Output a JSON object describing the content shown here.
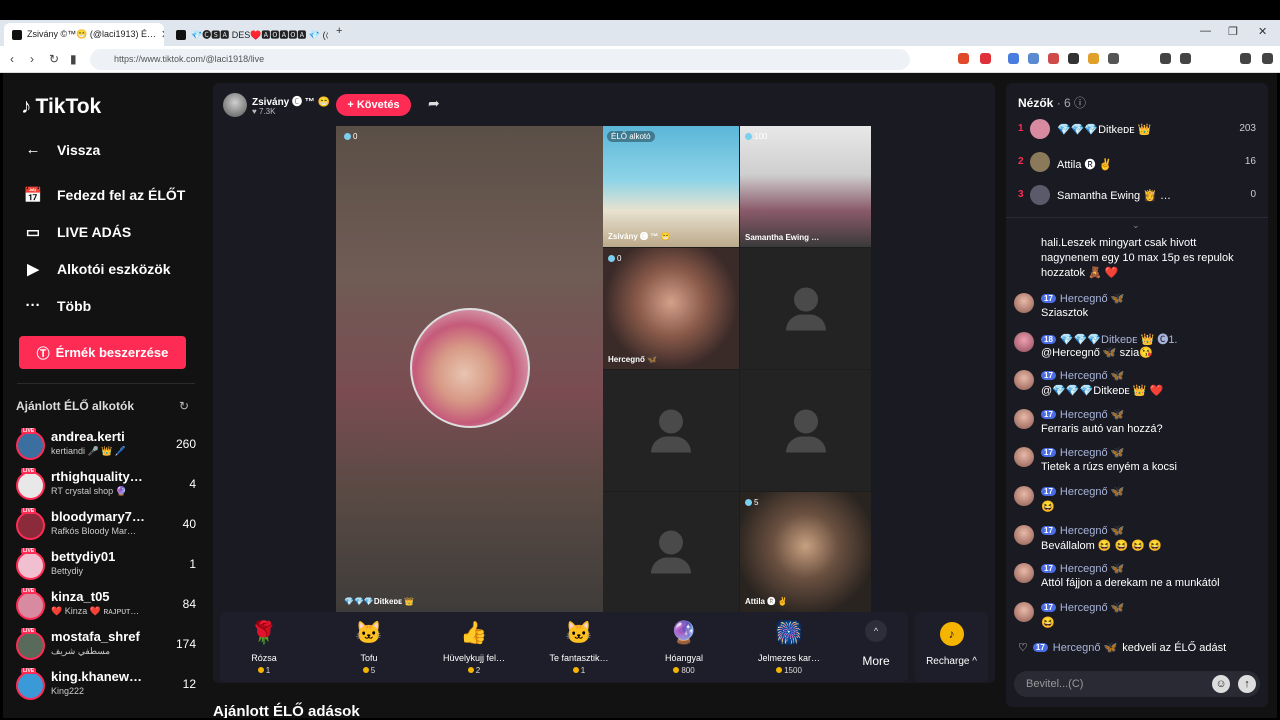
{
  "browser": {
    "tabs": [
      {
        "label": "Zsivány ©™😁 (@laci1913) É…",
        "close": "✕"
      },
      {
        "label": "💎🅒🆂🅰 DES♥️🅰🅾🅰🅾🅰 💎 (@csby0…",
        "close": "✕"
      }
    ],
    "new_tab": "+",
    "url": "https://www.tiktok.com/@laci1918/live",
    "window": {
      "min": "—",
      "max": "❐",
      "close": "✕"
    }
  },
  "sidebar": {
    "logo": "TikTok",
    "back": "Vissza",
    "nav": [
      {
        "label": "Fedezd fel az ÉLŐT",
        "icon": "📅"
      },
      {
        "label": "LIVE ADÁS",
        "icon": "▭"
      },
      {
        "label": "Alkotói eszközök",
        "icon": "▶"
      },
      {
        "label": "Több",
        "icon": "···"
      }
    ],
    "coin_button": "Érmék beszerzése",
    "recommended_title": "Ajánlott ÉLŐ alkotók",
    "live_tag": "LIVE",
    "creators": [
      {
        "name": "andrea.kerti",
        "sub": "kertiandi 🎤 👑 🖊️",
        "count": "260",
        "color": "#3a6fa0"
      },
      {
        "name": "rthighquality…",
        "sub": "RT crystal shop 🔮",
        "count": "4",
        "color": "#e8e8e8"
      },
      {
        "name": "bloodymary7…",
        "sub": "Rafkós Bloody Mar…",
        "count": "40",
        "color": "#8a2a3a"
      },
      {
        "name": "bettydiy01",
        "sub": "Bettydiy",
        "count": "1",
        "color": "#f0c0d0"
      },
      {
        "name": "kinza_t05",
        "sub": "❤️ Kinza ❤️ ʀᴀᴊᴘᴜᴛ…",
        "count": "84",
        "color": "#d88aa0"
      },
      {
        "name": "mostafa_shref",
        "sub": "مسطفي شريف",
        "count": "174",
        "color": "#5a6a5a"
      },
      {
        "name": "king.khanew…",
        "sub": "King222",
        "count": "12",
        "color": "#3a9ad8"
      }
    ]
  },
  "stream": {
    "host_name": "Zsivány 🅒 ™ 😁",
    "host_likes": "♥ 7.3K",
    "follow_label": "+ Követés",
    "main_viewers": "0",
    "main_label": "💎💎💎Ditkeᴅᴇ 👑",
    "tiles": [
      {
        "badge": "ÉLŐ alkotó",
        "name": "Zsivány 🅒 ™ 😁"
      },
      {
        "badge": "100",
        "name": "Samantha Ewing …"
      },
      {
        "badge": "0",
        "name": "Hercegnő 🦋"
      },
      {
        "badge": "5",
        "name": "Attila 🅡 ✌"
      }
    ]
  },
  "gifts": [
    {
      "name": "Rózsa",
      "price": "1",
      "icon": "🌹"
    },
    {
      "name": "Tofu",
      "price": "5",
      "icon": "🐱"
    },
    {
      "name": "Hüvelykujj fel…",
      "price": "2",
      "icon": "👍"
    },
    {
      "name": "Te fantasztik…",
      "price": "1",
      "icon": "🐱"
    },
    {
      "name": "Hóangyal",
      "price": "800",
      "icon": "🔮"
    },
    {
      "name": "Jelmezes kar…",
      "price": "1500",
      "icon": "🎆"
    }
  ],
  "more_label": "More",
  "recharge_label": "Recharge ^",
  "section_title": "Ajánlott ÉLŐ adások",
  "viewers_panel": {
    "title": "Nézők",
    "count": "· 6",
    "list": [
      {
        "rank": "1",
        "name": "💎💎💎Ditkeᴅᴇ 👑",
        "score": "203",
        "color": "#d88aa0"
      },
      {
        "rank": "2",
        "name": "Attila 🅡 ✌",
        "score": "16",
        "color": "#8a7a5a"
      },
      {
        "rank": "3",
        "name": "Samantha Ewing 👸 …",
        "score": "0",
        "color": "#5a5a6a"
      }
    ]
  },
  "chat": {
    "old_message": "hali.Leszek mingyart csak hivott nagynenem egy 10 max 15p es repulok hozzatok 🧸 ❤️",
    "messages": [
      {
        "level": "17",
        "name": "Hercegnő 🦋",
        "text": "Sziasztok"
      },
      {
        "level": "18",
        "name": "💎💎💎Ditkeᴅᴇ 👑 🅒1.",
        "text": "@Hercegnő 🦋 szia😘"
      },
      {
        "level": "17",
        "name": "Hercegnő 🦋",
        "text": "@💎💎💎Ditkeᴅᴇ 👑 ❤️"
      },
      {
        "level": "17",
        "name": "Hercegnő 🦋",
        "text": "Ferraris autó van hozzá?"
      },
      {
        "level": "17",
        "name": "Hercegnő 🦋",
        "text": "Tietek a rúzs enyém a kocsi"
      },
      {
        "level": "17",
        "name": "Hercegnő 🦋",
        "text": "😆"
      },
      {
        "level": "17",
        "name": "Hercegnő 🦋",
        "text": "Bevállalom 😆 😆 😆 😆"
      },
      {
        "level": "17",
        "name": "Hercegnő 🦋",
        "text": "Attól fájjon a derekam ne a munkától"
      },
      {
        "level": "17",
        "name": "Hercegnő 🦋",
        "text": "😆"
      }
    ],
    "like_level": "17",
    "like_name": "Hercegnő 🦋",
    "like_text": "kedveli az ÉLŐ adást",
    "input_placeholder": "Bevitel...(C)"
  }
}
